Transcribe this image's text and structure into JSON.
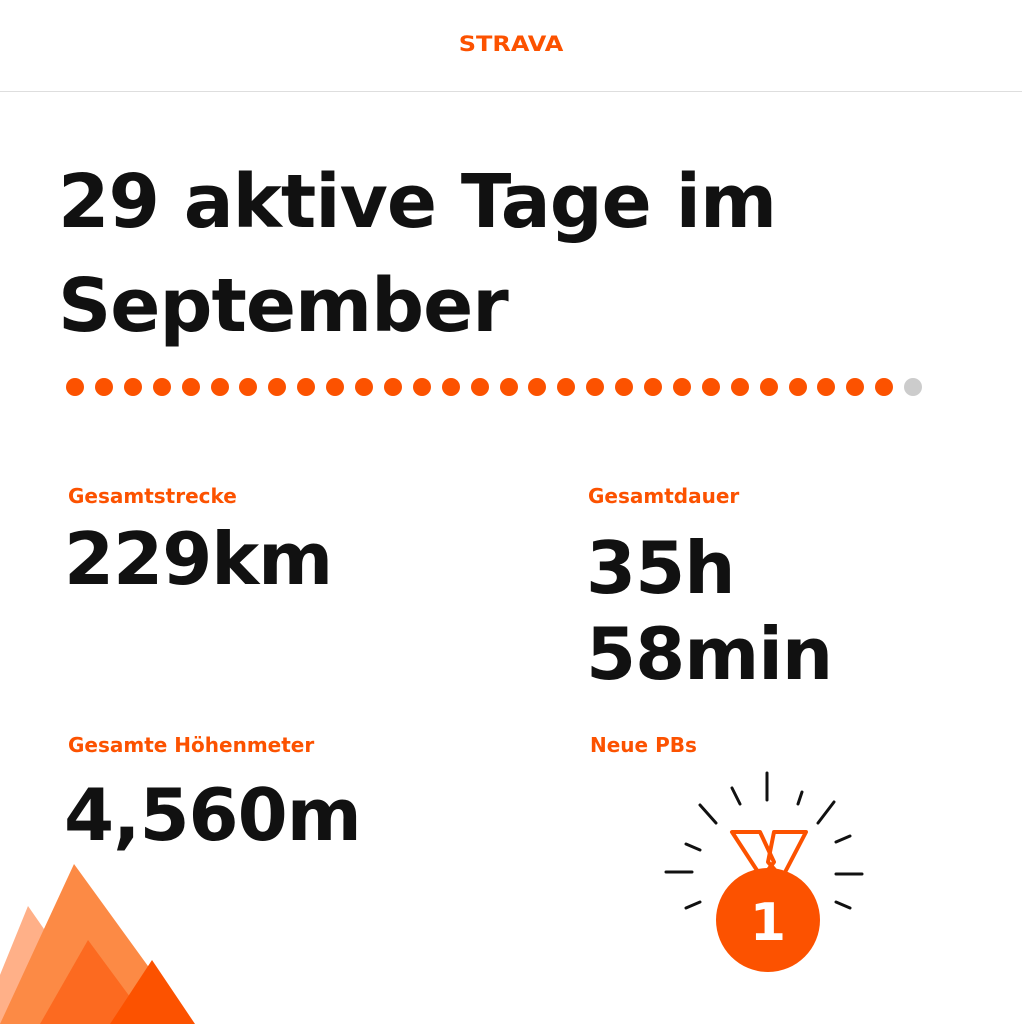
{
  "brand": {
    "logo_text": "STRAVA",
    "accent_color": "#fc5200"
  },
  "summary": {
    "title_line1": "29 aktive Tage im",
    "title_line2": "September",
    "active_days": 29,
    "total_days": 30
  },
  "stats": {
    "distance": {
      "label": "Gesamtstrecke",
      "value": "229km"
    },
    "duration": {
      "label": "Gesamtdauer",
      "value_line1": "35h",
      "value_line2": "58min"
    },
    "elevation": {
      "label": "Gesamte Höhenmeter",
      "value": "4,560m"
    },
    "pbs": {
      "label": "Neue PBs",
      "value": "1",
      "icon": "medal-icon"
    }
  },
  "decoration": {
    "icon": "mountains-icon"
  }
}
